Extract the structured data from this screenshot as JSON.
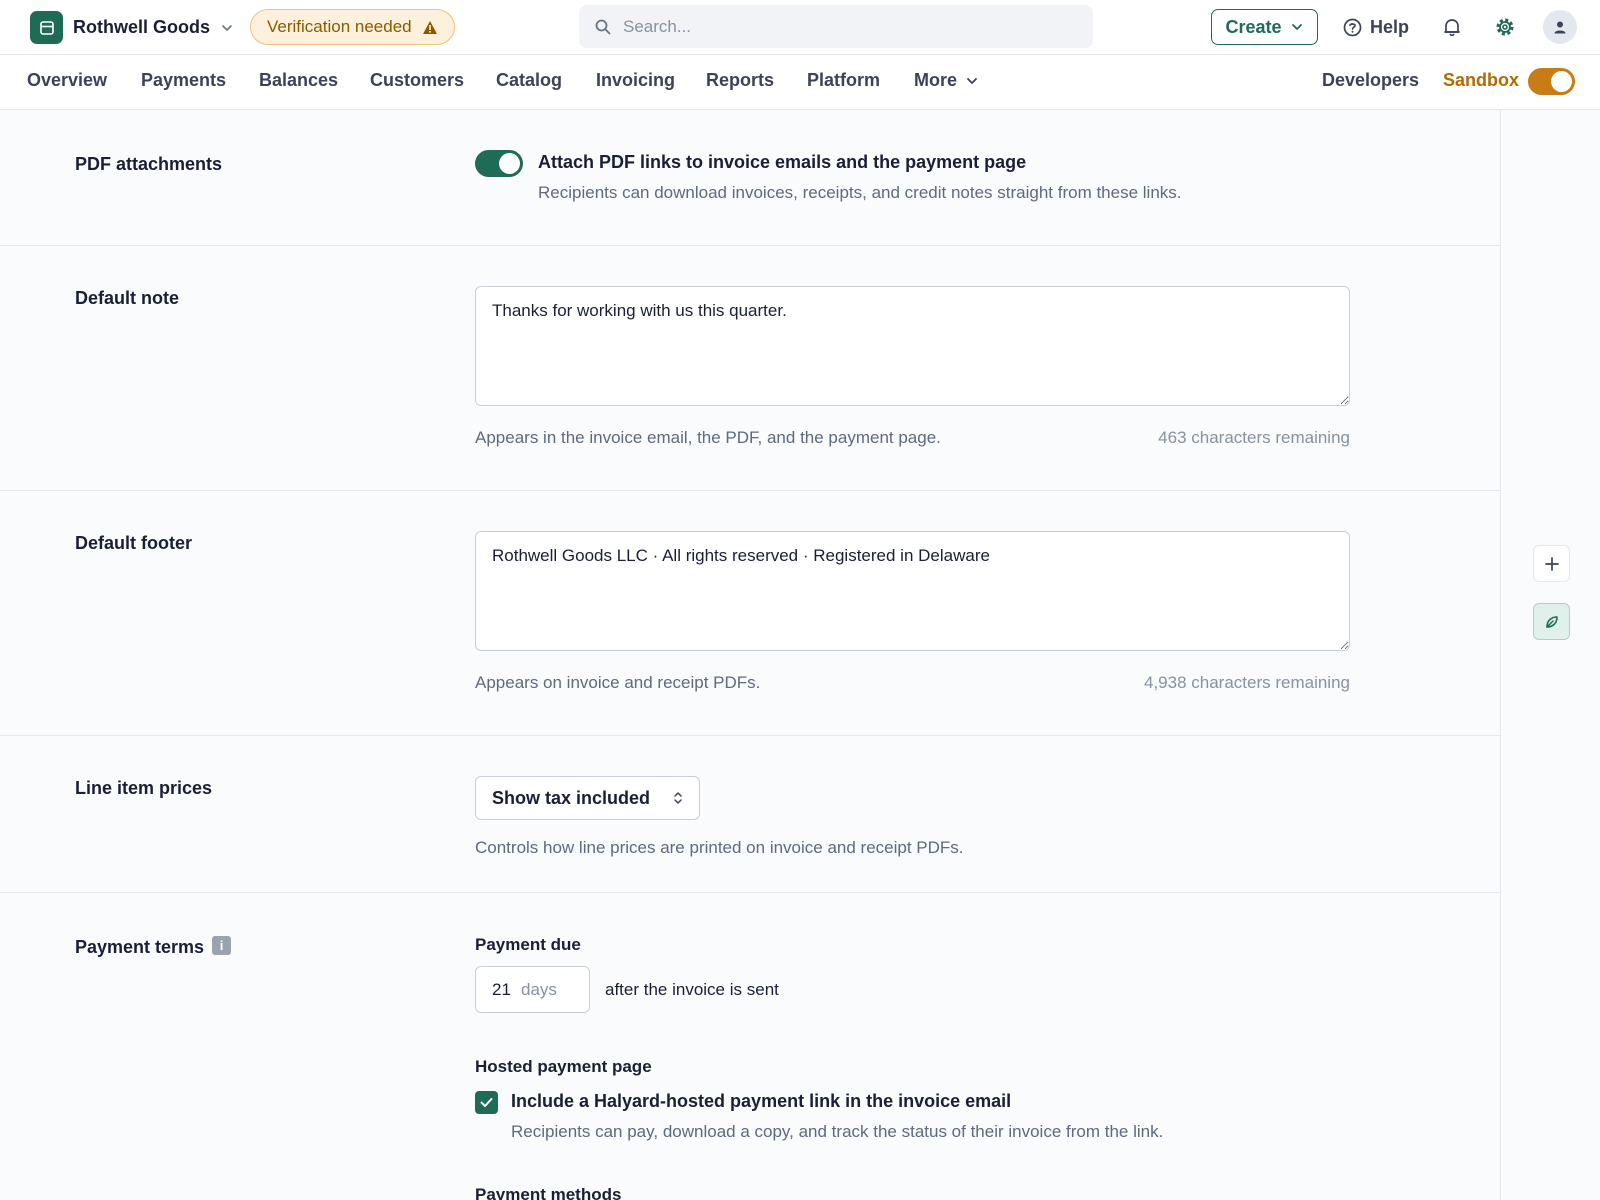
{
  "header": {
    "account_name": "Rothwell Goods",
    "verification_label": "Verification needed",
    "search_placeholder": "Search...",
    "create_label": "Create",
    "help_label": "Help"
  },
  "nav": {
    "items": [
      "Overview",
      "Payments",
      "Balances",
      "Customers",
      "Catalog",
      "Invoicing",
      "Reports",
      "Platform",
      "More"
    ],
    "developers_label": "Developers",
    "sandbox_label": "Sandbox",
    "sandbox_enabled": true
  },
  "pdf_attachments": {
    "label": "PDF attachments",
    "enabled": true,
    "title": "Attach PDF links to invoice emails and the payment page",
    "description": "Recipients can download invoices, receipts, and credit notes straight from these links."
  },
  "default_note": {
    "label": "Default note",
    "value": "Thanks for working with us this quarter.",
    "help": "Appears in the invoice email, the PDF, and the payment page.",
    "remaining": "463 characters remaining"
  },
  "default_footer": {
    "label": "Default footer",
    "value": "Rothwell Goods LLC · All rights reserved · Registered in Delaware",
    "help": "Appears on invoice and receipt PDFs.",
    "remaining": "4,938 characters remaining"
  },
  "line_item_prices": {
    "label": "Line item prices",
    "selected": "Show tax included",
    "help": "Controls how line prices are printed on invoice and receipt PDFs."
  },
  "payment_terms": {
    "label": "Payment terms",
    "info_glyph": "i",
    "payment_due_heading": "Payment due",
    "days_value": "21",
    "days_unit": "days",
    "days_suffix": "after the invoice is sent",
    "hosted_heading": "Hosted payment page",
    "hosted_checked": true,
    "hosted_title": "Include a Halyard-hosted payment link in the invoice email",
    "hosted_description": "Recipients can pay, download a copy, and track the status of their invoice from the link.",
    "payment_methods_heading": "Payment methods"
  },
  "colors": {
    "brand_green": "#1f6b55",
    "sandbox_orange": "#c97c15",
    "warning_bg": "#fdf0dc"
  }
}
